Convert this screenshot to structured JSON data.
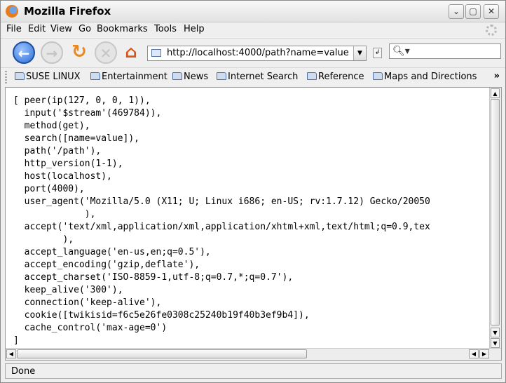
{
  "window": {
    "title": "Mozilla Firefox",
    "minimize": "⌄",
    "maximize": "▢",
    "close": "✕"
  },
  "menu": [
    "File",
    "Edit",
    "View",
    "Go",
    "Bookmarks",
    "Tools",
    "Help"
  ],
  "nav": {
    "url": "http://localhost:4000/path?name=value",
    "search_placeholder": ""
  },
  "bookmarks": [
    "SUSE LINUX",
    "Entertainment",
    "News",
    "Internet Search",
    "Reference",
    "Maps and Directions"
  ],
  "bookmarks_overflow": "»",
  "content": {
    "lines": [
      "[ peer(ip(127, 0, 0, 1)),",
      "  input('$stream'(469784)),",
      "  method(get),",
      "  search([name=value]),",
      "  path('/path'),",
      "  http_version(1-1),",
      "  host(localhost),",
      "  port(4000),",
      "  user_agent('Mozilla/5.0 (X11; U; Linux i686; en-US; rv:1.7.12) Gecko/20050",
      "             ),",
      "  accept('text/xml,application/xml,application/xhtml+xml,text/html;q=0.9,tex",
      "         ),",
      "  accept_language('en-us,en;q=0.5'),",
      "  accept_encoding('gzip,deflate'),",
      "  accept_charset('ISO-8859-1,utf-8;q=0.7,*;q=0.7'),",
      "  keep_alive('300'),",
      "  connection('keep-alive'),",
      "  cookie([twikisid=f6c5e26fe0308c25240b19f40b3ef9b4]),",
      "  cache_control('max-age=0')",
      "]"
    ]
  },
  "status": "Done"
}
